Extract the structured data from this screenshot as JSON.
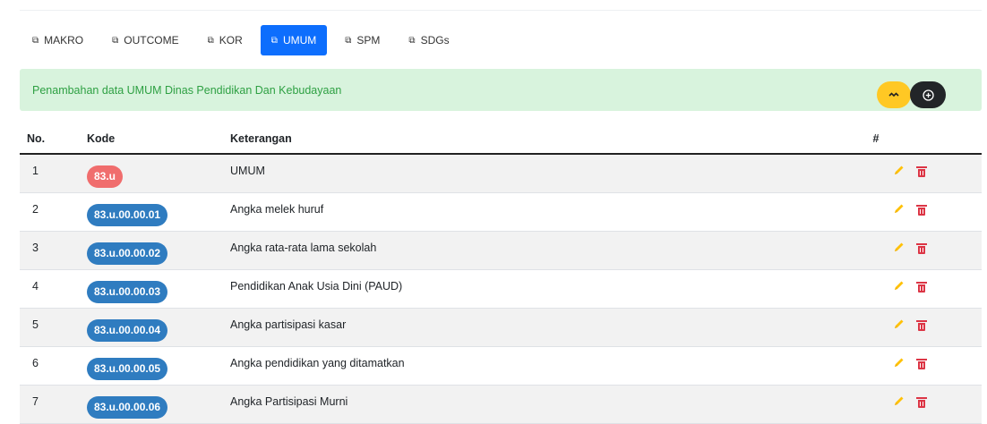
{
  "tabs": [
    {
      "label": "MAKRO",
      "icon": "copy-icon",
      "active": false
    },
    {
      "label": "OUTCOME",
      "icon": "copy-icon",
      "active": false
    },
    {
      "label": "KOR",
      "icon": "copy-icon",
      "active": false
    },
    {
      "label": "UMUM",
      "icon": "copy-icon",
      "active": true
    },
    {
      "label": "SPM",
      "icon": "copy-icon",
      "active": false
    },
    {
      "label": "SDGs",
      "icon": "copy-icon",
      "active": false
    }
  ],
  "alert": {
    "text": "Penambahan data UMUM Dinas Pendidikan Dan Kebudayaan",
    "buttons": [
      {
        "icon": "chevrons-icon",
        "color": "#ffc824"
      },
      {
        "icon": "plus-circle-icon",
        "color": "#222528"
      }
    ]
  },
  "table": {
    "headers": [
      "No.",
      "Kode",
      "Keterangan",
      "#"
    ],
    "rows": [
      {
        "no": "1",
        "kode": "83.u",
        "kode_color": "red",
        "keterangan": "UMUM"
      },
      {
        "no": "2",
        "kode": "83.u.00.00.01",
        "kode_color": "blue",
        "keterangan": "Angka melek huruf"
      },
      {
        "no": "3",
        "kode": "83.u.00.00.02",
        "kode_color": "blue",
        "keterangan": "Angka rata-rata lama sekolah"
      },
      {
        "no": "4",
        "kode": "83.u.00.00.03",
        "kode_color": "blue",
        "keterangan": "Pendidikan Anak Usia Dini (PAUD)"
      },
      {
        "no": "5",
        "kode": "83.u.00.00.04",
        "kode_color": "blue",
        "keterangan": "Angka partisipasi kasar"
      },
      {
        "no": "6",
        "kode": "83.u.00.00.05",
        "kode_color": "blue",
        "keterangan": "Angka pendidikan yang ditamatkan"
      },
      {
        "no": "7",
        "kode": "83.u.00.00.06",
        "kode_color": "blue",
        "keterangan": "Angka Partisipasi Murni"
      }
    ],
    "actions": [
      {
        "icon": "pencil-icon",
        "color": "#ffc107"
      },
      {
        "icon": "trash-icon",
        "color": "#dc3545"
      }
    ]
  },
  "colors": {
    "accent": "#0d6efd",
    "alert_bg": "#d8f3dd",
    "alert_text": "#2ea043"
  }
}
